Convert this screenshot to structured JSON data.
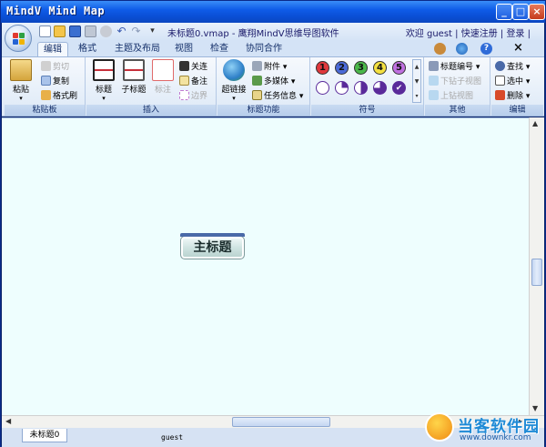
{
  "window": {
    "title": "MindV Mind Map"
  },
  "document": {
    "filename": "未标题0.vmap",
    "separator": "-",
    "app_name": "鹰翔MindV思维导图软件"
  },
  "user": {
    "welcome": "欢迎 guest",
    "quick_register": "快速注册",
    "login": "登录"
  },
  "tabs": [
    "编辑",
    "格式",
    "主题及布局",
    "视图",
    "检查",
    "协同合作"
  ],
  "ribbon": {
    "clipboard": {
      "label": "粘贴板",
      "paste": "粘贴",
      "cut": "剪切",
      "copy": "复制",
      "format_painter": "格式刷"
    },
    "insert": {
      "label": "插入",
      "topic": "标题",
      "subtopic": "子标题",
      "callout": "标注",
      "relation": "关连",
      "note": "备注",
      "boundary": "边界"
    },
    "topic_features": {
      "label": "标题功能",
      "hyperlink": "超链接",
      "attachment": "附件",
      "multimedia": "多媒体",
      "task_info": "任务信息"
    },
    "symbols": {
      "label": "符号",
      "numbers": [
        "1",
        "2",
        "3",
        "4",
        "5"
      ]
    },
    "other": {
      "label": "其他",
      "numbering": "标题编号",
      "to_subview": "下钻子视图",
      "to_parent": "上钻视图"
    },
    "edit": {
      "label": "编辑",
      "find": "查找",
      "select": "选中",
      "delete": "删除"
    }
  },
  "canvas": {
    "main_topic": "主标题",
    "background_color": "#eefefe"
  },
  "bottom": {
    "sheet_tab": "未标题0",
    "status_user": "guest"
  },
  "watermark": {
    "text": "当客软件园",
    "url": "www.downkr.com"
  },
  "colors": {
    "title_bar": "#0f5ce8",
    "ribbon_bg": "#dde9f7",
    "accent": "#15306a"
  }
}
